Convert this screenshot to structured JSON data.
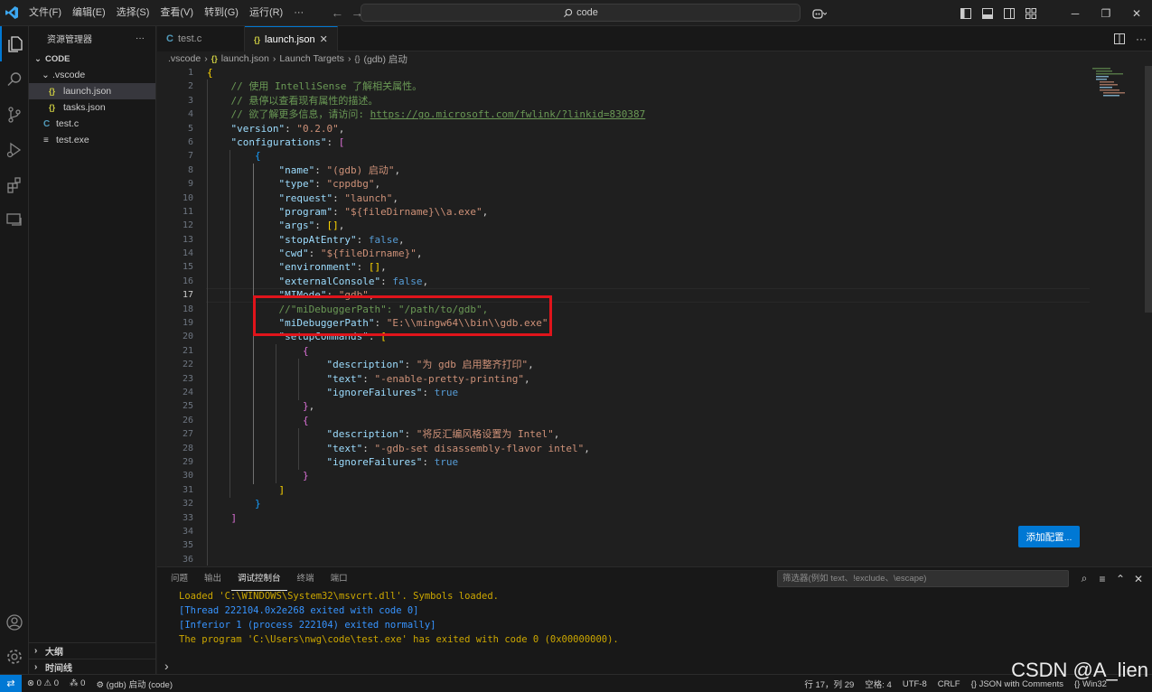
{
  "titlebar": {
    "menus": [
      "文件(F)",
      "编辑(E)",
      "选择(S)",
      "查看(V)",
      "转到(G)",
      "运行(R)",
      "···"
    ],
    "search_text": "code",
    "search_icon": "search-icon"
  },
  "sidebar": {
    "title": "资源管理器",
    "more": "···",
    "root": "CODE",
    "items": [
      {
        "label": ".vscode",
        "icon": "›",
        "indent": 1
      },
      {
        "label": "launch.json",
        "icon": "{}",
        "indent": 2,
        "active": true
      },
      {
        "label": "tasks.json",
        "icon": "{}",
        "indent": 2
      },
      {
        "label": "test.c",
        "icon": "C",
        "indent": 1
      },
      {
        "label": "test.exe",
        "icon": "≡",
        "indent": 1
      }
    ],
    "outline": "大纲",
    "timeline": "时间线"
  },
  "tabs": [
    {
      "label": "test.c",
      "icon": "C",
      "active": false
    },
    {
      "label": "launch.json",
      "icon": "{}",
      "active": true,
      "close": "✕"
    }
  ],
  "breadcrumb": [
    ".vscode",
    "launch.json",
    "Launch Targets",
    "(gdb) 启动"
  ],
  "editor": {
    "line_numbers": [
      "1",
      "2",
      "3",
      "4",
      "5",
      "6",
      "7",
      "8",
      "9",
      "10",
      "11",
      "12",
      "13",
      "14",
      "15",
      "16",
      "17",
      "18",
      "19",
      "20",
      "21",
      "22",
      "23",
      "24",
      "25",
      "26",
      "27",
      "28",
      "29",
      "30",
      "31",
      "32",
      "33",
      "34",
      "35",
      "36"
    ],
    "current_line": "17",
    "add_config_button": "添加配置..."
  },
  "panel": {
    "tabs": [
      "问题",
      "输出",
      "调试控制台",
      "终端",
      "端口"
    ],
    "active_tab": "调试控制台",
    "filter_placeholder": "筛选器(例如 text、!exclude、\\escape)",
    "console_lines": [
      {
        "text": "Loaded 'C:\\WINDOWS\\System32\\msvcrt.dll'. Symbols loaded.",
        "color": "yellow"
      },
      {
        "text": "[Thread 222104.0x2e268 exited with code 0]",
        "color": "blue"
      },
      {
        "text": "[Inferior 1 (process 222104) exited normally]",
        "color": "blue"
      },
      {
        "text": "The program 'C:\\Users\\nwg\\code\\test.exe' has exited with code 0 (0x00000000).",
        "color": "yellow"
      }
    ],
    "prompt": "›"
  },
  "statusbar": {
    "errors": "0",
    "warnings": "0",
    "ports": "0",
    "debug_config": "(gdb) 启动 (code)",
    "cursor": "行 17，列 29",
    "spaces": "空格: 4",
    "encoding": "UTF-8",
    "eol": "CRLF",
    "language": "JSON with Comments",
    "platform": "Win32"
  },
  "watermark": "CSDN @A_lien",
  "colors": {
    "accent": "#0078d4",
    "highlight_box": "#e0141b"
  }
}
